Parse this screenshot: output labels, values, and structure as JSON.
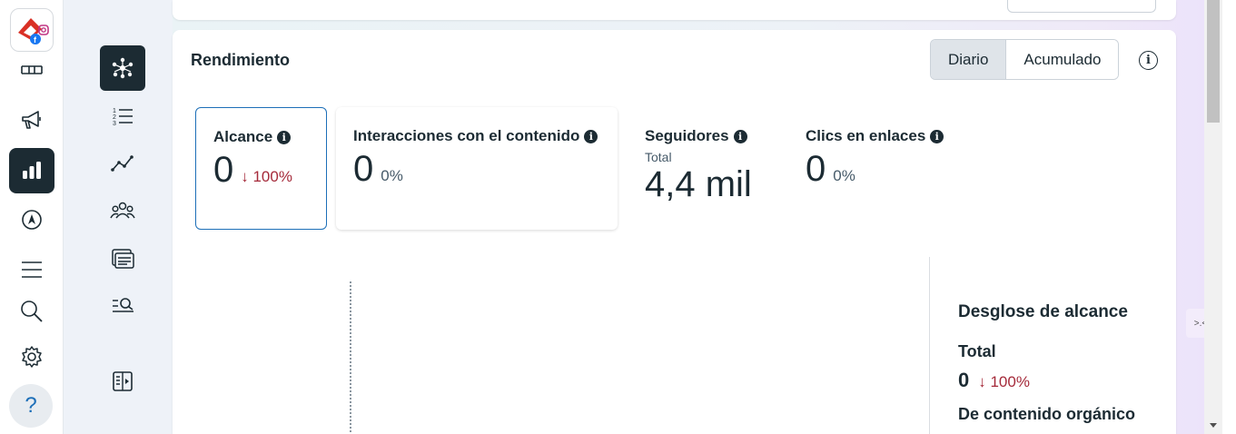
{
  "rail": {
    "logo": "meta-business-logo",
    "items": [
      {
        "icon": "grid-icon"
      },
      {
        "icon": "megaphone-icon"
      },
      {
        "icon": "bar-chart-icon",
        "active": true
      },
      {
        "icon": "compass-icon"
      },
      {
        "icon": "menu-icon"
      },
      {
        "icon": "search-icon"
      },
      {
        "icon": "gear-icon"
      }
    ],
    "help_label": "?"
  },
  "subnav": {
    "items": [
      {
        "icon": "hub-icon",
        "active": true
      },
      {
        "icon": "numbered-list-icon"
      },
      {
        "icon": "trend-line-icon"
      },
      {
        "icon": "audience-icon"
      },
      {
        "icon": "content-card-icon"
      },
      {
        "icon": "search-list-icon"
      },
      {
        "icon": "panel-toggle-icon"
      }
    ]
  },
  "card": {
    "title": "Rendimiento",
    "toggle": {
      "options": [
        "Diario",
        "Acumulado"
      ],
      "selected": "Diario"
    },
    "info_icon": "i"
  },
  "metrics": [
    {
      "label": "Alcance",
      "value": "0",
      "change": "↓ 100%",
      "selected": true
    },
    {
      "label": "Interacciones con el contenido",
      "value": "0",
      "change": "0%"
    },
    {
      "label": "Seguidores",
      "sub": "Total",
      "value": "4,4 mil"
    },
    {
      "label": "Clics en enlaces",
      "value": "0",
      "change": "0%"
    }
  ],
  "breakdown": {
    "title": "Desglose de alcance",
    "total_label": "Total",
    "total_value": "0",
    "total_change": "↓ 100%",
    "organic_label": "De contenido orgánico"
  },
  "colors": {
    "dark": "#1c2b33",
    "accent_blue": "#1d6fb8",
    "negative": "#a52a3a"
  }
}
